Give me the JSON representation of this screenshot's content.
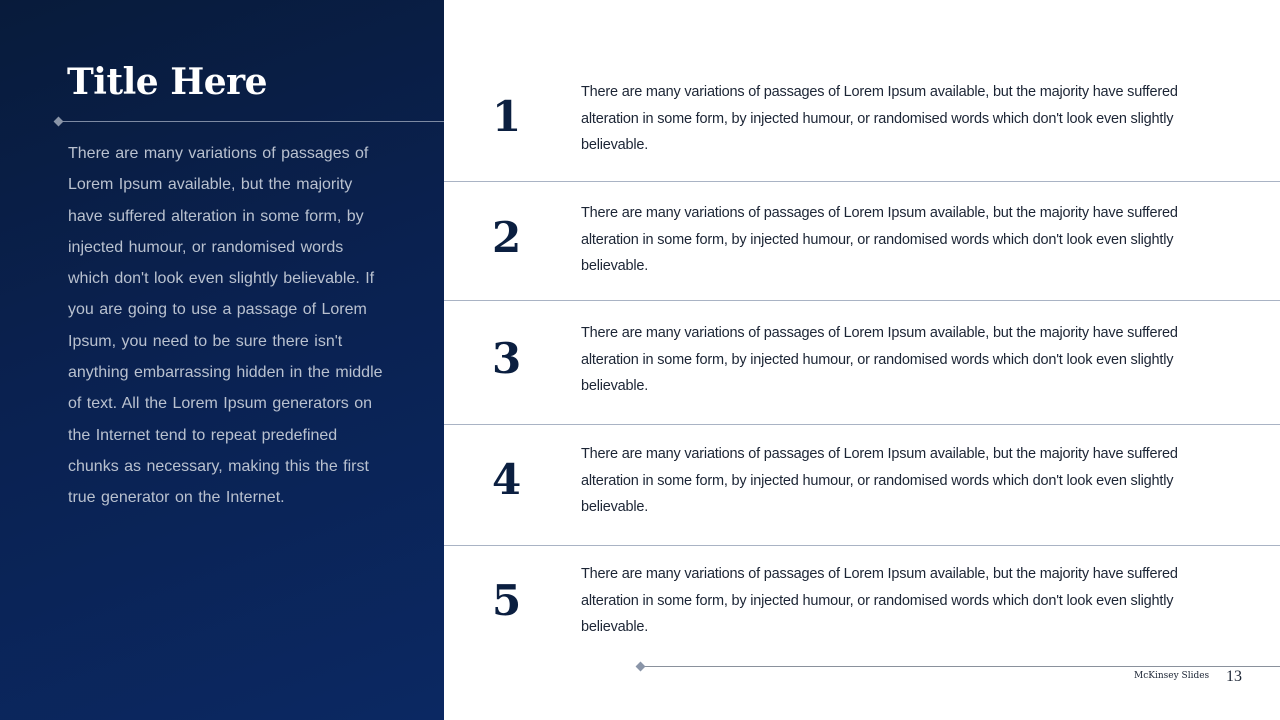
{
  "left_panel": {
    "title": "Title Here",
    "body": "There are many variations of passages of Lorem Ipsum available, but the majority have suffered alteration in some form, by injected humour, or randomised words which don't look even slightly believable. If you are going to use a passage of Lorem Ipsum, you need to be sure there isn't anything embarrassing hidden in the middle of text. All the Lorem Ipsum generators on the Internet tend to repeat predefined chunks as necessary, making this the first true generator on the Internet."
  },
  "items": [
    {
      "number": "1",
      "text": "There are many variations of passages of Lorem Ipsum available, but the majority have suffered alteration in some form, by injected humour, or randomised words which don't look even slightly believable."
    },
    {
      "number": "2",
      "text": "There are many variations of passages of Lorem Ipsum available, but the majority have suffered alteration in some form, by injected humour, or randomised words which don't look even slightly believable."
    },
    {
      "number": "3",
      "text": "There are many variations of passages of Lorem Ipsum available, but the majority have suffered alteration in some form, by injected humour, or randomised words which don't look even slightly believable."
    },
    {
      "number": "4",
      "text": "There are many variations of passages of Lorem Ipsum available, but the majority have suffered alteration in some form, by injected humour, or randomised words which don't look even slightly believable."
    },
    {
      "number": "5",
      "text": "There are many variations of passages of Lorem Ipsum available, but the majority have suffered alteration in some form, by injected humour, or randomised words which don't look even slightly believable."
    }
  ],
  "footer": {
    "brand": "McKinsey Slides",
    "page_number": "13"
  },
  "colors": {
    "panel_dark": "#081b3b",
    "panel_light": "#0b2862",
    "number_color": "#0b1f40"
  }
}
